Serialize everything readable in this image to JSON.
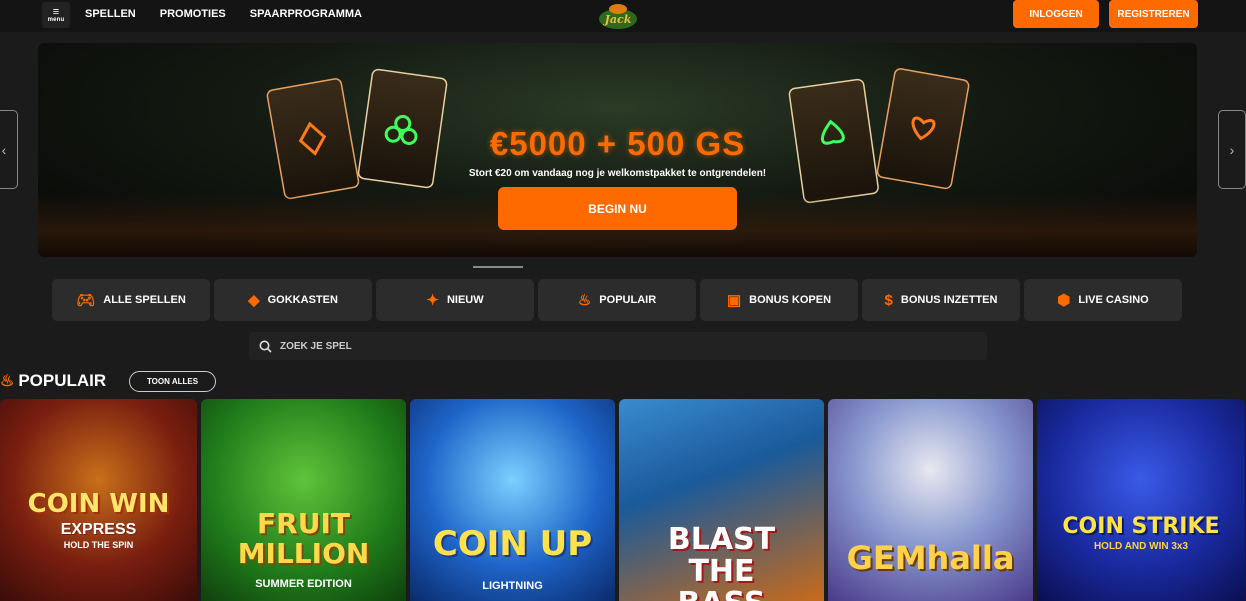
{
  "header": {
    "menu_label": "menu",
    "nav": [
      "SPELLEN",
      "PROMOTIES",
      "SPAARPROGRAMMA"
    ],
    "logo_text": "Jack",
    "login_label": "INLOGGEN",
    "register_label": "REGISTREREN"
  },
  "banner": {
    "headline": "€5000 + 500 GS",
    "subline": "Stort €20 om vandaag nog je welkomstpakket te ontgrendelen!",
    "cta_label": "BEGIN NU"
  },
  "categories": [
    {
      "label": "ALLE SPELLEN",
      "icon": "gamepad-icon"
    },
    {
      "label": "GOKKASTEN",
      "icon": "diamond-icon"
    },
    {
      "label": "NIEUW",
      "icon": "sparkle-icon"
    },
    {
      "label": "POPULAIR",
      "icon": "flame-icon"
    },
    {
      "label": "BONUS KOPEN",
      "icon": "gift-icon"
    },
    {
      "label": "BONUS INZETTEN",
      "icon": "money-bag-icon"
    },
    {
      "label": "LIVE CASINO",
      "icon": "cube-icon"
    }
  ],
  "search": {
    "placeholder": "ZOEK JE SPEL"
  },
  "section": {
    "title": "POPULAIR",
    "show_all_label": "TOON ALLES"
  },
  "games": [
    {
      "title": "COIN WIN",
      "sub": "EXPRESS",
      "tag": "HOLD THE SPIN"
    },
    {
      "title": "FRUIT MILLION",
      "sub": "SUMMER EDITION"
    },
    {
      "title": "COIN UP",
      "sub": "LIGHTNING"
    },
    {
      "title": "BLAST THE BASS"
    },
    {
      "title": "GEMhalla"
    },
    {
      "title": "COIN STRIKE",
      "sub": "HOLD AND WIN 3x3"
    }
  ],
  "colors": {
    "accent": "#ff6a00",
    "background": "#1b1b1b",
    "tile": "#2c2c2c"
  }
}
